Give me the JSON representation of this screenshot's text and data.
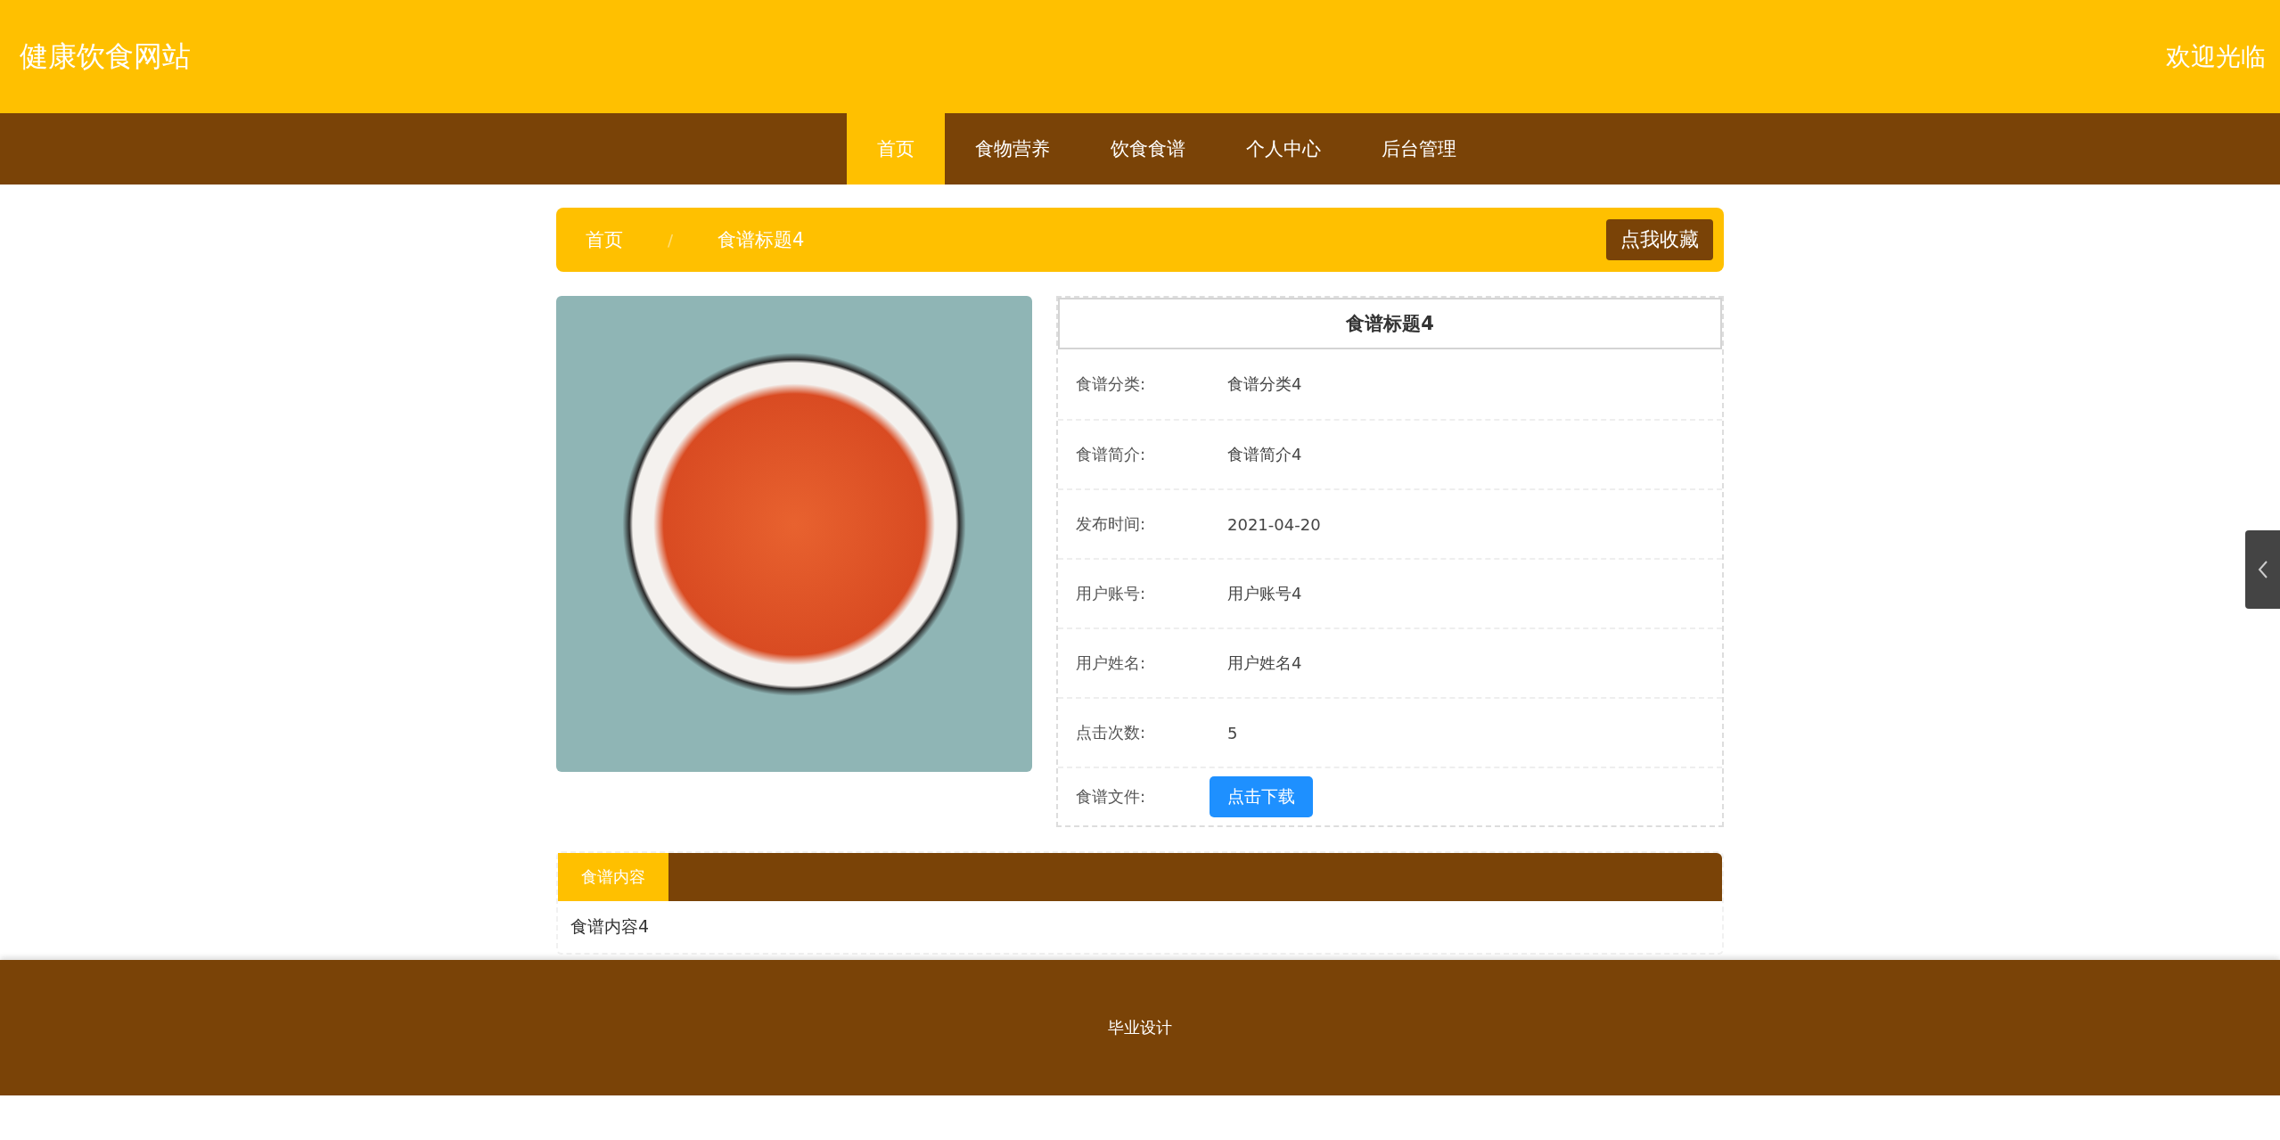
{
  "header": {
    "site_title": "健康饮食网站",
    "welcome": "欢迎光临"
  },
  "nav": [
    {
      "label": "首页",
      "selected": true
    },
    {
      "label": "食物营养",
      "selected": false
    },
    {
      "label": "饮食食谱",
      "selected": false
    },
    {
      "label": "个人中心",
      "selected": false
    },
    {
      "label": "后台管理",
      "selected": false
    }
  ],
  "breadcrumb": {
    "items": [
      "首页",
      "食谱标题4"
    ],
    "separator": "/",
    "favorite_button": "点我收藏"
  },
  "detail": {
    "title": "食谱标题4",
    "fields": [
      {
        "kind": "text",
        "label": "食谱分类:",
        "value": "食谱分类4"
      },
      {
        "kind": "text",
        "label": "食谱简介:",
        "value": "食谱简介4"
      },
      {
        "kind": "text",
        "label": "发布时间:",
        "value": "2021-04-20"
      },
      {
        "kind": "text",
        "label": "用户账号:",
        "value": "用户账号4"
      },
      {
        "kind": "text",
        "label": "用户姓名:",
        "value": "用户姓名4"
      },
      {
        "kind": "text",
        "label": "点击次数:",
        "value": "5"
      },
      {
        "kind": "button",
        "label": "食谱文件:",
        "value": "点击下载"
      }
    ]
  },
  "content_tabs": [
    {
      "label": "食谱内容",
      "selected": true
    }
  ],
  "content_text": "食谱内容4",
  "footer": {
    "text": "毕业设计"
  }
}
